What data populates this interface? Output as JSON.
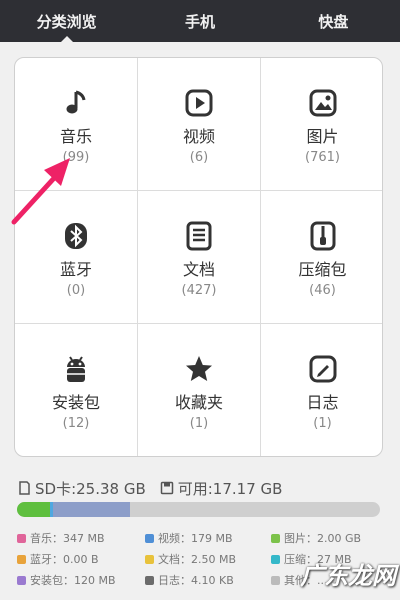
{
  "tabs": [
    {
      "label": "分类浏览",
      "active": true
    },
    {
      "label": "手机",
      "active": false
    },
    {
      "label": "快盘",
      "active": false
    }
  ],
  "categories": [
    {
      "label": "音乐",
      "count": "(99)",
      "icon": "music-note-icon"
    },
    {
      "label": "视频",
      "count": "(6)",
      "icon": "video-play-icon"
    },
    {
      "label": "图片",
      "count": "(761)",
      "icon": "picture-icon"
    },
    {
      "label": "蓝牙",
      "count": "(0)",
      "icon": "bluetooth-icon"
    },
    {
      "label": "文档",
      "count": "(427)",
      "icon": "document-icon"
    },
    {
      "label": "压缩包",
      "count": "(46)",
      "icon": "zip-archive-icon"
    },
    {
      "label": "安装包",
      "count": "(12)",
      "icon": "android-icon"
    },
    {
      "label": "收藏夹",
      "count": "(1)",
      "icon": "star-icon"
    },
    {
      "label": "日志",
      "count": "(1)",
      "icon": "log-edit-icon"
    }
  ],
  "storage": {
    "sd_label": "SD卡:25.38 GB",
    "available_label": "可用:17.17 GB",
    "usage_fraction_segments": [
      {
        "color": "#5fbf3f",
        "fraction": 0.09
      },
      {
        "color": "#4fa8e0",
        "fraction": 0.01
      },
      {
        "color": "#8d9ec9",
        "fraction": 0.21
      }
    ]
  },
  "legend": [
    {
      "text": "音乐：347 MB",
      "color": "#e0659a"
    },
    {
      "text": "视频：179 MB",
      "color": "#4f8fd6"
    },
    {
      "text": "图片：2.00 GB",
      "color": "#7cc24a"
    },
    {
      "text": "蓝牙：0.00 B",
      "color": "#e8a33b"
    },
    {
      "text": "文档：2.50 MB",
      "color": "#e8c23b"
    },
    {
      "text": "压缩：27 MB",
      "color": "#35b8c9"
    },
    {
      "text": "安装包：120 MB",
      "color": "#9a7ad0"
    },
    {
      "text": "日志：4.10 KB",
      "color": "#6b6b6b"
    },
    {
      "text": "其他：...",
      "color": "#bbbbbb"
    }
  ],
  "watermark": "广东龙网",
  "colors": {
    "tab_bg": "#2e2f34",
    "annotation_arrow": "#ee2266"
  }
}
